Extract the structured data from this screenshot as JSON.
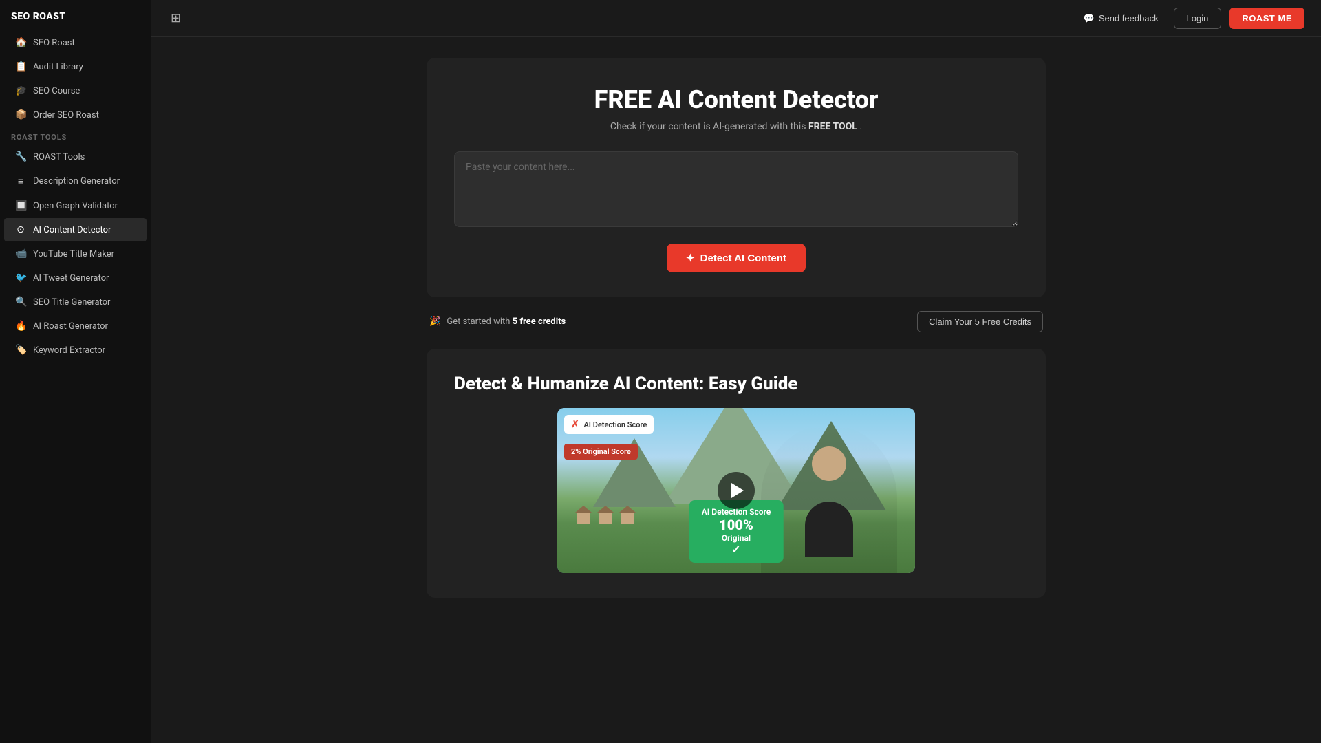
{
  "brand": {
    "logo": "SEO ROAST"
  },
  "sidebar": {
    "toggle_icon": "☰",
    "nav_items": [
      {
        "id": "seo-roast",
        "label": "SEO Roast",
        "icon": "🏠",
        "active": false
      },
      {
        "id": "audit-library",
        "label": "Audit Library",
        "icon": "📋",
        "active": false
      },
      {
        "id": "seo-course",
        "label": "SEO Course",
        "icon": "🎓",
        "active": false
      },
      {
        "id": "order-seo-roast",
        "label": "Order SEO Roast",
        "icon": "📦",
        "active": false
      }
    ],
    "section_label": "ROAST Tools",
    "tool_items": [
      {
        "id": "roast-tools",
        "label": "ROAST Tools",
        "icon": "🔧",
        "active": false
      },
      {
        "id": "description-generator",
        "label": "Description Generator",
        "icon": "≡",
        "active": false
      },
      {
        "id": "open-graph-validator",
        "label": "Open Graph Validator",
        "icon": "🔲",
        "active": false
      },
      {
        "id": "ai-content-detector",
        "label": "AI Content Detector",
        "icon": "⊙",
        "active": true
      },
      {
        "id": "youtube-title-maker",
        "label": "YouTube Title Maker",
        "icon": "📹",
        "active": false
      },
      {
        "id": "ai-tweet-generator",
        "label": "AI Tweet Generator",
        "icon": "🐦",
        "active": false
      },
      {
        "id": "seo-title-generator",
        "label": "SEO Title Generator",
        "icon": "🔍",
        "active": false
      },
      {
        "id": "ai-roast-generator",
        "label": "AI Roast Generator",
        "icon": "🔥",
        "active": false
      },
      {
        "id": "keyword-extractor",
        "label": "Keyword Extractor",
        "icon": "🏷️",
        "active": false
      }
    ]
  },
  "header": {
    "feedback_icon": "💬",
    "feedback_label": "Send feedback",
    "login_label": "Login",
    "roast_me_label": "ROAST ME"
  },
  "main_card": {
    "title": "FREE AI Content Detector",
    "subtitle_prefix": "Check if your content is AI-generated with this",
    "subtitle_highlight": "FREE TOOL",
    "subtitle_suffix": ".",
    "textarea_placeholder": "Paste your content here...",
    "detect_btn_icon": "✦",
    "detect_btn_label": "Detect AI Content"
  },
  "credits_bar": {
    "emoji": "🎉",
    "text_prefix": "Get started with",
    "text_highlight": "5 free credits",
    "claim_btn_label": "Claim Your 5 Free Credits"
  },
  "video_card": {
    "title": "Detect & Humanize AI Content: Easy Guide",
    "overlay_top_label": "AI Detection Score",
    "overlay_red_label": "2% Original Score",
    "overlay_green_label1": "AI Detection Score",
    "overlay_green_pct": "100%",
    "overlay_green_label2": "Original",
    "play_label": "▶"
  }
}
